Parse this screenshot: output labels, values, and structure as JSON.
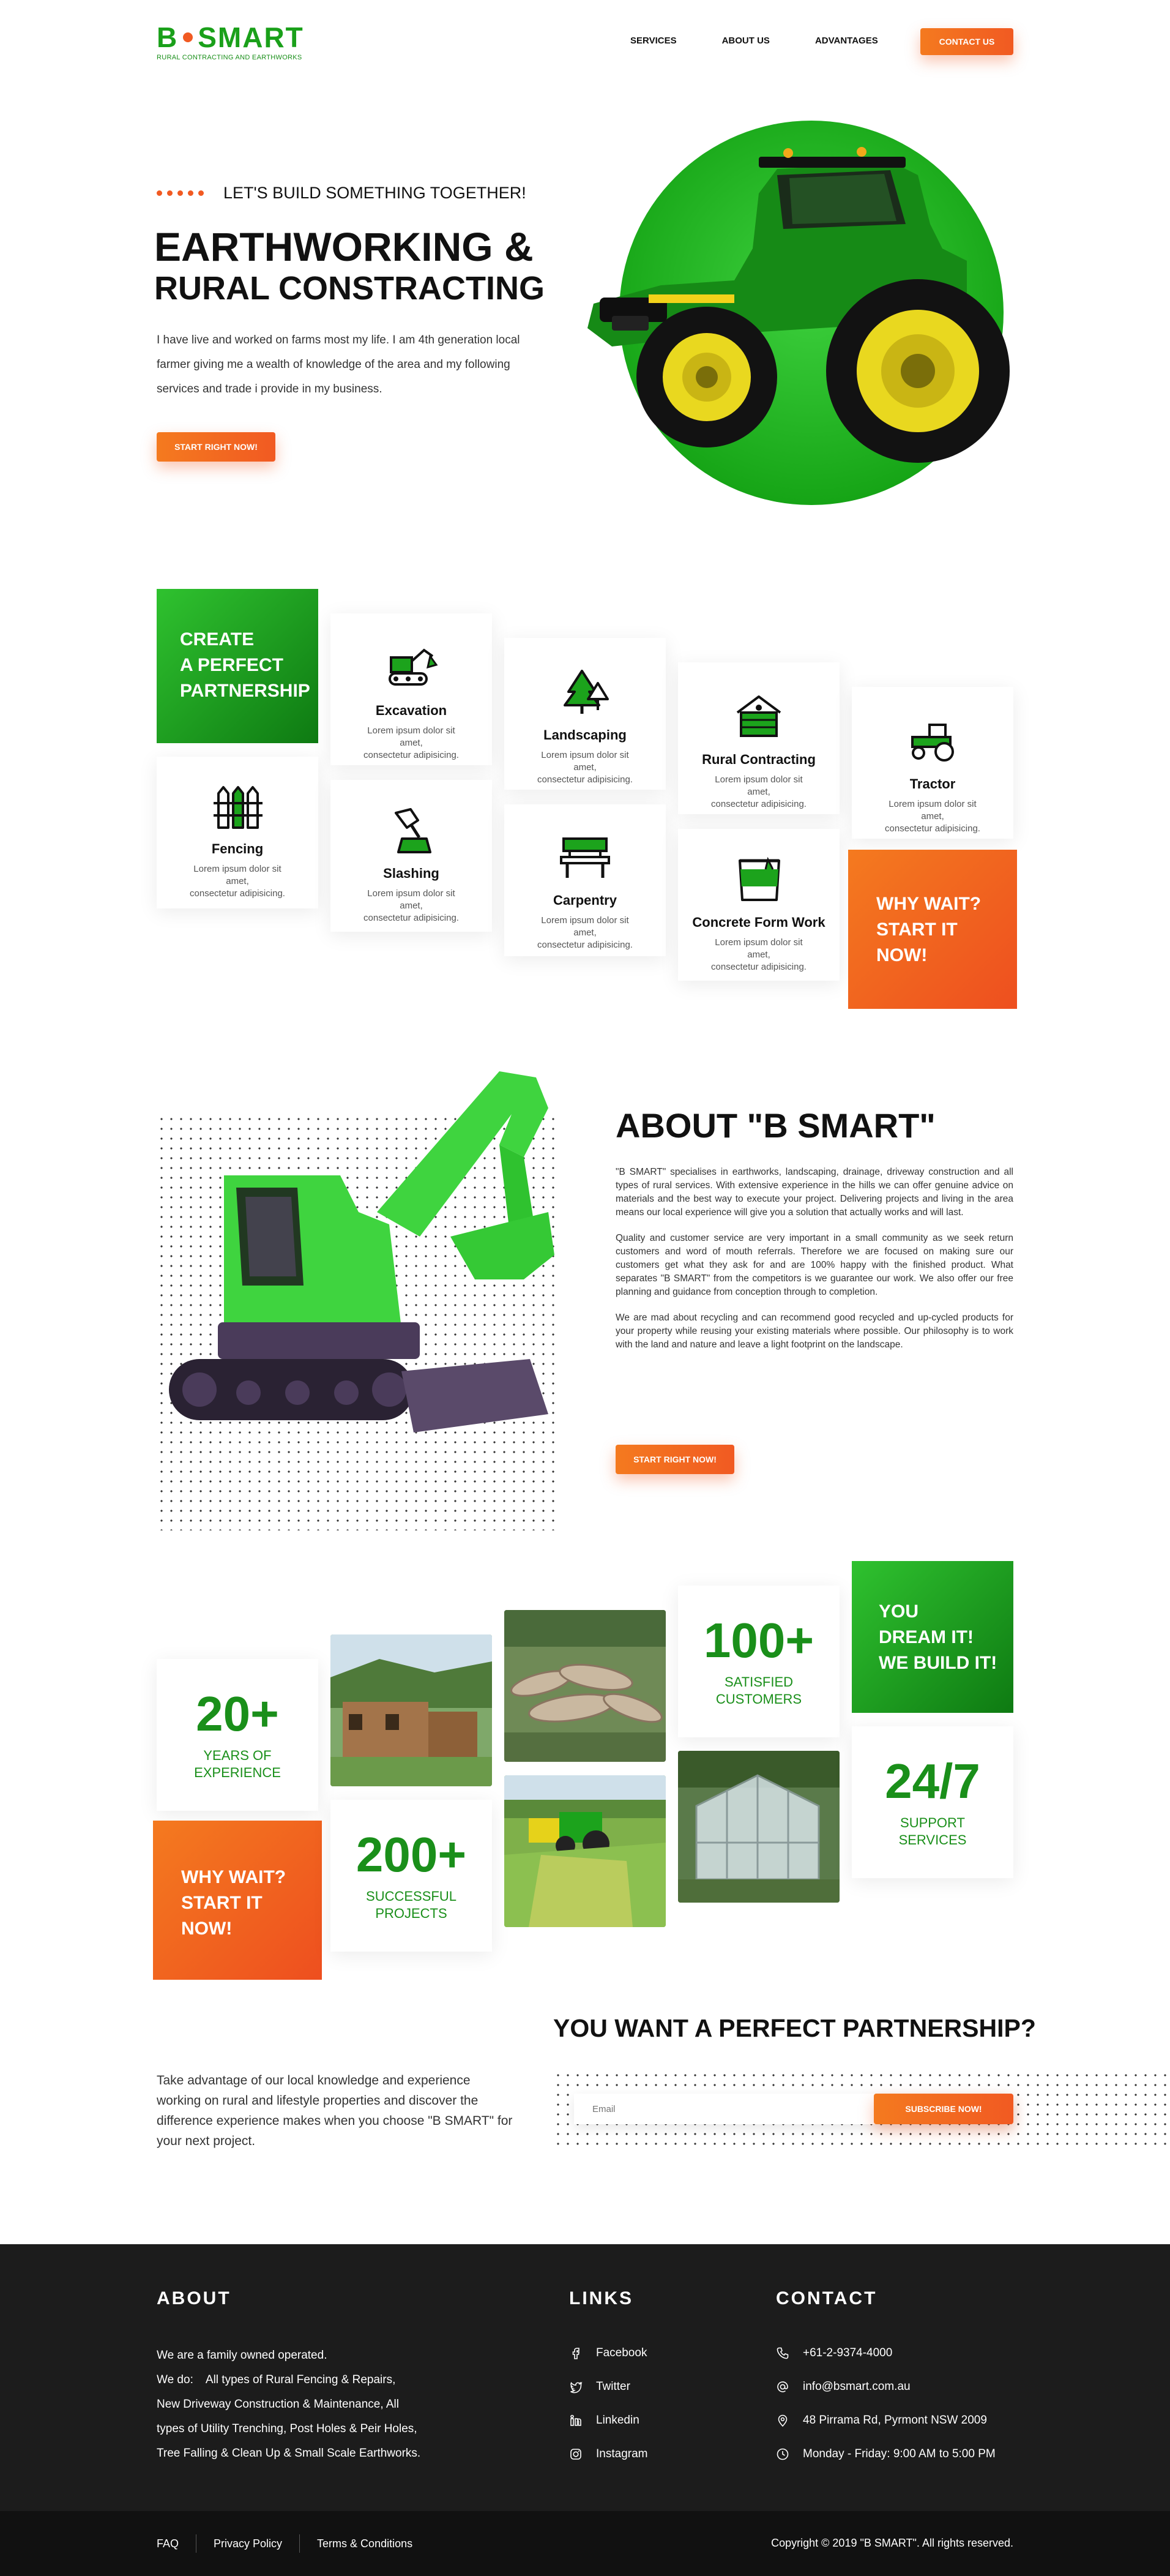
{
  "brand": {
    "logo_letter": "B",
    "logo_word": "SMART",
    "tagline": "RURAL CONTRACTING AND EARTHWORKS"
  },
  "nav": {
    "items": [
      "SERVICES",
      "ABOUT US",
      "ADVANTAGES"
    ],
    "contact_label": "CONTACT US"
  },
  "hero": {
    "eyebrow": "LET'S BUILD SOMETHING TOGETHER!",
    "title_line1": "EARTHWORKING &",
    "title_line2": "RURAL CONSTRACTING",
    "body": "I have live and worked on farms most my life. I am 4th generation local farmer giving me a wealth of knowledge of the area and my following services and trade i provide in my business.",
    "cta": "START RIGHT NOW!"
  },
  "services": {
    "intro": [
      "CREATE",
      "A PERFECT",
      "PARTNERSHIP"
    ],
    "outro": [
      "WHY WAIT?",
      "START IT",
      "NOW!"
    ],
    "desc_line1": "Lorem ipsum dolor sit amet,",
    "desc_line2": "consectetur adipisicing.",
    "items": [
      {
        "title": "Excavation",
        "icon": "excavator-icon"
      },
      {
        "title": "Landscaping",
        "icon": "trees-icon"
      },
      {
        "title": "Rural Contracting",
        "icon": "log-cabin-icon"
      },
      {
        "title": "Tractor",
        "icon": "tractor-icon"
      },
      {
        "title": "Fencing",
        "icon": "fence-icon"
      },
      {
        "title": "Slashing",
        "icon": "slashing-icon"
      },
      {
        "title": "Carpentry",
        "icon": "bench-icon"
      },
      {
        "title": "Concrete Form Work",
        "icon": "bucket-icon"
      }
    ]
  },
  "about": {
    "title": "ABOUT \"B SMART\"",
    "p1": "\"B SMART\" specialises in earthworks, landscaping, drainage, driveway construction and all types of rural services. With extensive experience in the hills we can offer genuine advice on materials and the best way to execute your project. Delivering projects and living in the area means our local experience will give you a solution that actually works and will last.",
    "p2": "Quality and customer service are very important in a small community as we seek return customers and word of mouth referrals. Therefore we are focused on making sure our customers get what they ask for and are 100% happy with the finished product. What separates \"B SMART\" from the competitors is we guarantee our work. We also offer our free planning and guidance from conception through to completion.",
    "p3": "We are mad about recycling and can recommend good recycled and up-cycled products for your property while reusing your existing materials where possible. Our philosophy is to work with the land and nature and leave a light footprint on the landscape.",
    "cta": "START RIGHT NOW!"
  },
  "advantages": {
    "years": {
      "num": "20+",
      "label1": "YEARS OF",
      "label2": "EXPERIENCE"
    },
    "projects": {
      "num": "200+",
      "label1": "SUCCESSFUL",
      "label2": "PROJECTS"
    },
    "customers": {
      "num": "100+",
      "label1": "SATISFIED",
      "label2": "CUSTOMERS"
    },
    "support": {
      "num": "24/7",
      "label1": "SUPPORT",
      "label2": "SERVICES"
    },
    "dream": [
      "YOU",
      "DREAM IT!",
      "WE BUILD IT!"
    ],
    "wait": [
      "WHY WAIT?",
      "START IT",
      "NOW!"
    ]
  },
  "partnership": {
    "title": "YOU WANT A PERFECT PARTNERSHIP?",
    "body": "Take advantage of our local knowledge and experience working on rural and lifestyle properties and discover the difference experience makes when you choose \"B SMART\" for your next project.",
    "email_placeholder": "Email",
    "subscribe": "SUBSCRIBE NOW!"
  },
  "footer": {
    "about_h": "ABOUT",
    "about_lines": [
      "We are a family owned operated.",
      "We do:    All types of Rural Fencing & Repairs,",
      "New Driveway Construction & Maintenance, All",
      "types of Utility Trenching, Post Holes & Peir Holes,",
      "Tree Falling & Clean Up & Small Scale Earthworks."
    ],
    "links_h": "LINKS",
    "links": [
      "Facebook",
      "Twitter",
      "Linkedin",
      "Instagram"
    ],
    "contact_h": "CONTACT",
    "contacts": [
      "+61-2-9374-4000",
      "info@bsmart.com.au",
      "48 Pirrama Rd, Pyrmont NSW 2009",
      "Monday - Friday: 9:00 AM to 5:00 PM"
    ],
    "bottom_links": [
      "FAQ",
      "Privacy Policy",
      "Terms & Conditions"
    ],
    "copyright": "Copyright © 2019 \"B SMART\". All rights reserved."
  },
  "colors": {
    "green": "#1a8f1a",
    "orange": "#f15a22",
    "dark": "#1c1c1c"
  }
}
